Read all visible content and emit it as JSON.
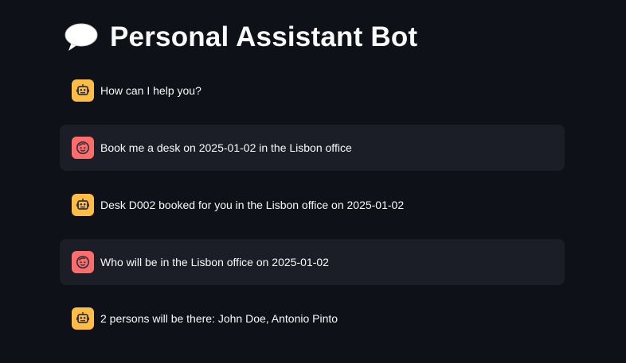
{
  "header": {
    "title": "Personal Assistant Bot",
    "icon": "speech-balloon-icon"
  },
  "chat": {
    "messages": [
      {
        "role": "assistant",
        "avatar_icon": "robot-icon",
        "text": "How can I help you?"
      },
      {
        "role": "user",
        "avatar_icon": "smiley-face-icon",
        "text": "Book me a desk on 2025-01-02 in the Lisbon office"
      },
      {
        "role": "assistant",
        "avatar_icon": "robot-icon",
        "text": "Desk D002 booked for you in the Lisbon office on 2025-01-02"
      },
      {
        "role": "user",
        "avatar_icon": "smiley-face-icon",
        "text": "Who will be in the Lisbon office on 2025-01-02"
      },
      {
        "role": "assistant",
        "avatar_icon": "robot-icon",
        "text": "2 persons will be there: John Doe, Antonio Pinto"
      }
    ]
  },
  "colors": {
    "background": "#0e1117",
    "user_bubble": "#1b1e26",
    "assistant_avatar": "#ffbd45",
    "user_avatar": "#ff6c6c",
    "text": "#fafafa"
  }
}
